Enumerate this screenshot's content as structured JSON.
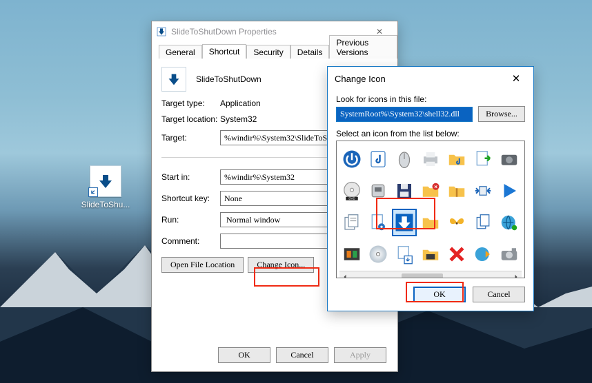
{
  "desktop": {
    "shortcut_label": "SlideToShu..."
  },
  "props": {
    "title": "SlideToShutDown Properties",
    "tabs": [
      "General",
      "Shortcut",
      "Security",
      "Details",
      "Previous Versions"
    ],
    "active_tab": "Shortcut",
    "shortcut_name": "SlideToShutDown",
    "labels": {
      "target_type": "Target type:",
      "target_location": "Target location:",
      "target": "Target:",
      "start_in": "Start in:",
      "shortcut_key": "Shortcut key:",
      "run": "Run:",
      "comment": "Comment:"
    },
    "values": {
      "target_type": "Application",
      "target_location": "System32",
      "target": "%windir%\\System32\\SlideToShu",
      "start_in": "%windir%\\System32",
      "shortcut_key": "None",
      "run": "Normal window",
      "comment": ""
    },
    "buttons": {
      "open_file_location": "Open File Location",
      "change_icon": "Change Icon...",
      "ok": "OK",
      "cancel": "Cancel",
      "apply": "Apply"
    }
  },
  "ci": {
    "title": "Change Icon",
    "look_label": "Look for icons in this file:",
    "path": "SystemRoot%\\System32\\shell32.dll",
    "browse": "Browse...",
    "select_label": "Select an icon from the list below:",
    "ok": "OK",
    "cancel": "Cancel",
    "selected_index": 16
  }
}
